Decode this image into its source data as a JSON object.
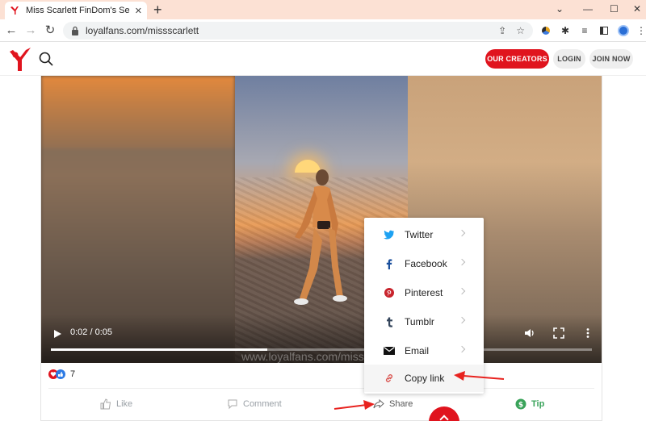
{
  "browser": {
    "tab_title": "Miss Scarlett FinDom's Secret S",
    "tab_close": "✕",
    "new_tab": "+",
    "url": "loyalfans.com/missscarlett",
    "window_controls": [
      "⌄",
      "—",
      "☐",
      "✕"
    ]
  },
  "site": {
    "buttons": {
      "creators": "OUR CREATORS",
      "login": "LOGIN",
      "join": "JOIN NOW"
    }
  },
  "video": {
    "timecode": "0:02 / 0:05",
    "progress": 0.4,
    "watermark": "www.loyalfans.com/missscarlett"
  },
  "post": {
    "reaction_count": "7",
    "actions": {
      "like": "Like",
      "comment": "Comment",
      "share": "Share",
      "tip": "Tip"
    }
  },
  "share_menu": {
    "items": [
      {
        "label": "Twitter",
        "icon": "twitter-icon"
      },
      {
        "label": "Facebook",
        "icon": "facebook-icon"
      },
      {
        "label": "Pinterest",
        "icon": "pinterest-icon"
      },
      {
        "label": "Tumblr",
        "icon": "tumblr-icon"
      },
      {
        "label": "Email",
        "icon": "email-icon"
      },
      {
        "label": "Copy link",
        "icon": "link-icon"
      }
    ]
  },
  "colors": {
    "brand_red": "#e0141e",
    "tip_green": "#3aa35a",
    "annotation_red": "#e8231f"
  }
}
